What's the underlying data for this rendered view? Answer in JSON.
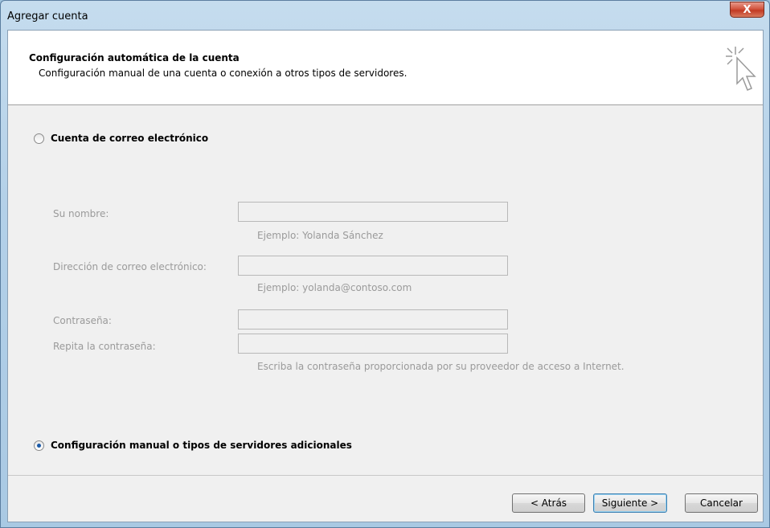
{
  "window": {
    "title": "Agregar cuenta",
    "close_glyph": "X"
  },
  "header": {
    "title": "Configuración automática de la cuenta",
    "subtitle": "Configuración manual de una cuenta o conexión a otros tipos de servidores.",
    "icon": "wizard-cursor-icon"
  },
  "options": {
    "email_account_label": "Cuenta de correo electrónico",
    "email_account_selected": false,
    "manual_label": "Configuración manual o tipos de servidores adicionales",
    "manual_selected": true
  },
  "form": {
    "name_label": "Su nombre:",
    "name_value": "",
    "name_hint": "Ejemplo: Yolanda Sánchez",
    "email_label": "Dirección de correo electrónico:",
    "email_value": "",
    "email_hint": "Ejemplo: yolanda@contoso.com",
    "password_label": "Contraseña:",
    "password_value": "",
    "repeat_label": "Repita la contraseña:",
    "repeat_value": "",
    "password_hint": "Escriba la contraseña proporcionada por su proveedor de acceso a Internet."
  },
  "buttons": {
    "back": "< Atrás",
    "next": "Siguiente >",
    "cancel": "Cancelar"
  }
}
